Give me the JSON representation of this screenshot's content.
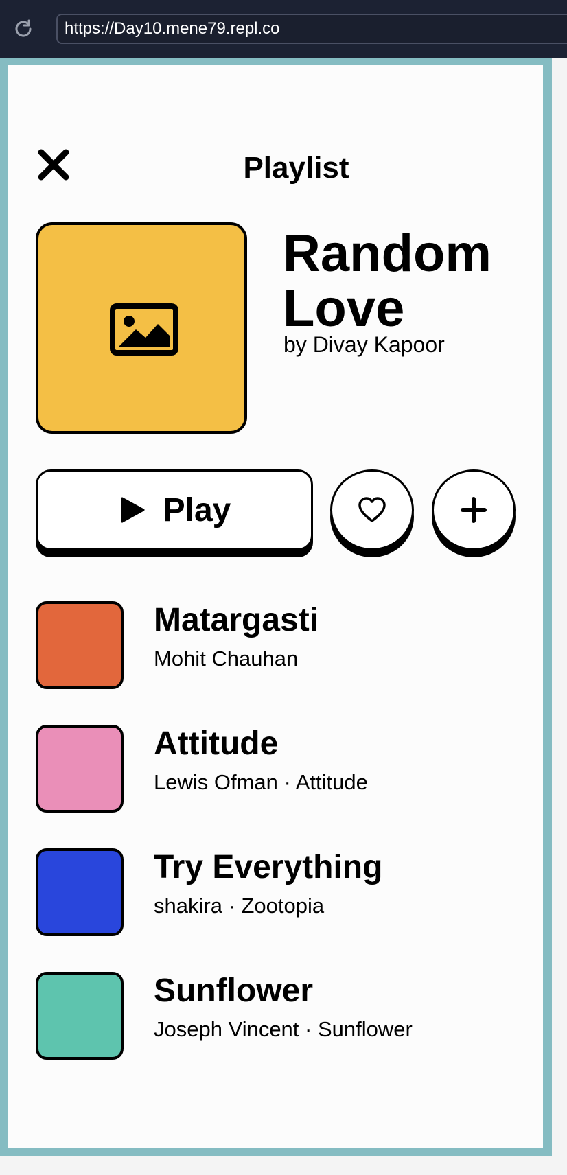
{
  "browser": {
    "url": "https://Day10.mene79.repl.co",
    "reload_icon": "reload-icon"
  },
  "header": {
    "title": "Playlist",
    "close_icon": "close-icon"
  },
  "playlist": {
    "name": "Random Love",
    "author": "by Divay Kapoor",
    "cover_color": "#f4bf45",
    "cover_icon": "image-icon"
  },
  "actions": {
    "play_label": "Play",
    "play_icon": "play-icon",
    "like_icon": "heart-icon",
    "add_icon": "plus-icon"
  },
  "tracks": [
    {
      "title": "Matargasti",
      "subtitle": "Mohit Chauhan",
      "color": "#e2673c"
    },
    {
      "title": "Attitude",
      "subtitle": "Lewis Ofman · Attitude",
      "color": "#ea8fb8"
    },
    {
      "title": "Try Everything",
      "subtitle": "shakira · Zootopia",
      "color": "#2946dc"
    },
    {
      "title": "Sunflower",
      "subtitle": "Joseph Vincent · Sunflower",
      "color": "#5ec4ae"
    }
  ]
}
